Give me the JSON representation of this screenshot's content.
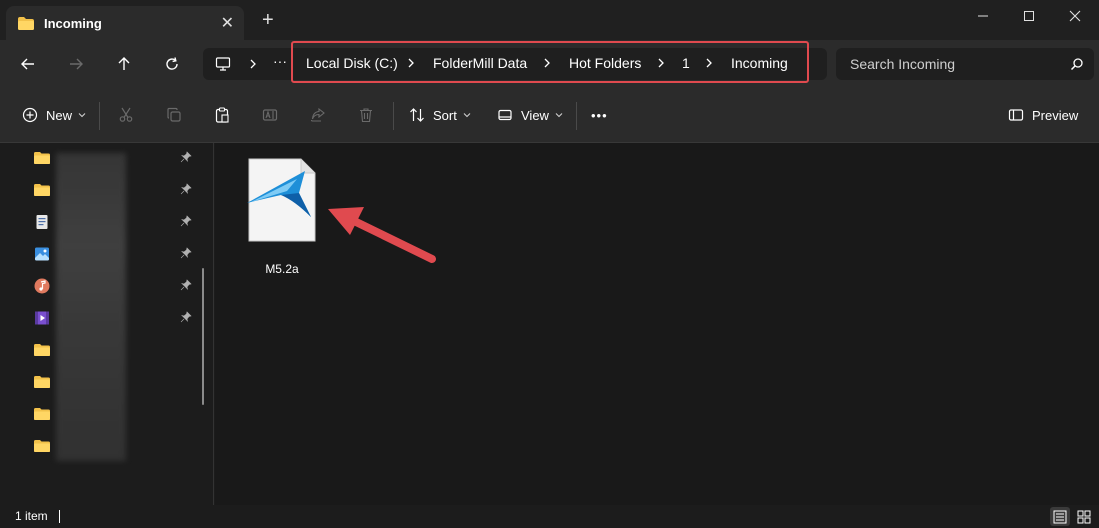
{
  "window": {
    "tab_title": "Incoming",
    "tab_icon": "folder-icon",
    "close_tab": "✕",
    "new_tab": "+"
  },
  "address": {
    "overflow_label": "···",
    "breadcrumbs": [
      "Local Disk (C:)",
      "FolderMill Data",
      "Hot Folders",
      "1",
      "Incoming"
    ],
    "highlight_color": "#e04a4f"
  },
  "search": {
    "placeholder": "Search Incoming"
  },
  "toolbar": {
    "new_label": "New",
    "sort_label": "Sort",
    "view_label": "View",
    "more_label": "•••",
    "preview_label": "Preview"
  },
  "navigation": {
    "items": [
      {
        "icon": "folder-icon",
        "pinned": true
      },
      {
        "icon": "folder-icon",
        "pinned": true
      },
      {
        "icon": "document-icon",
        "pinned": true
      },
      {
        "icon": "pictures-icon",
        "pinned": true
      },
      {
        "icon": "music-icon",
        "pinned": true
      },
      {
        "icon": "videos-icon",
        "pinned": true
      },
      {
        "icon": "folder-icon",
        "pinned": false
      },
      {
        "icon": "folder-icon",
        "pinned": false
      },
      {
        "icon": "folder-icon",
        "pinned": false
      },
      {
        "icon": "folder-icon",
        "pinned": false
      }
    ]
  },
  "content": {
    "files": [
      {
        "name": "M5.2a",
        "icon": "foldermill-file-icon"
      }
    ],
    "annotation": "red-arrow-icon"
  },
  "status": {
    "item_count": "1 item"
  },
  "colors": {
    "accent_red": "#e04a4f",
    "folder_yellow": "#f2c14a",
    "background": "#1c1c1c"
  }
}
